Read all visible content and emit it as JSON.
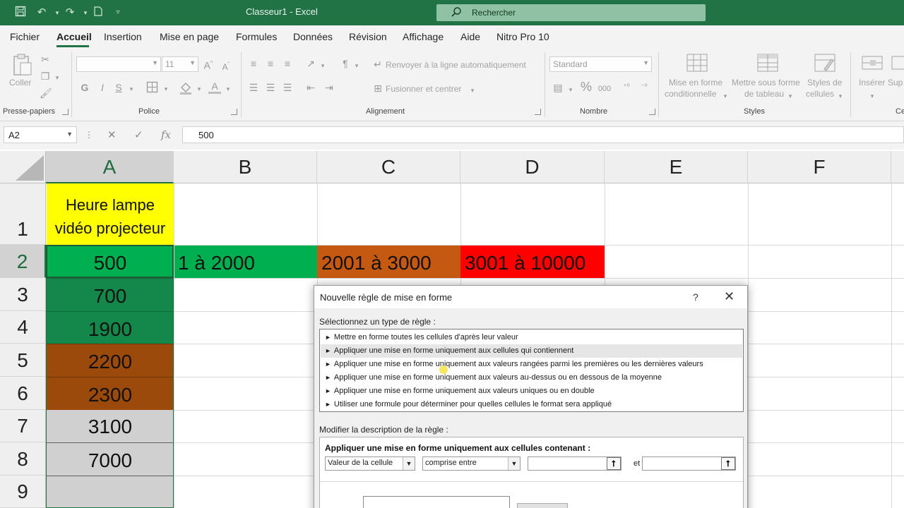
{
  "titlebar": {
    "doc_title": "Classeur1  -  Excel",
    "search_placeholder": "Rechercher"
  },
  "menu": {
    "tabs": [
      "Fichier",
      "Accueil",
      "Insertion",
      "Mise en page",
      "Formules",
      "Données",
      "Révision",
      "Affichage",
      "Aide",
      "Nitro Pro 10"
    ],
    "active": "Accueil"
  },
  "ribbon": {
    "clipboard": {
      "paste_label": "Coller",
      "group_label": "Presse-papiers"
    },
    "font": {
      "font_name": "",
      "font_size": "11",
      "bold": "G",
      "italic": "I",
      "underline": "S",
      "group_label": "Police"
    },
    "alignment": {
      "wrap_text": "Renvoyer à la ligne automatiquement",
      "merge_center": "Fusionner et centrer",
      "group_label": "Alignement"
    },
    "number": {
      "format": "Standard",
      "group_label": "Nombre"
    },
    "styles": {
      "conditional": [
        "Mise en forme",
        "conditionnelle"
      ],
      "as_table": [
        "Mettre sous forme",
        "de tableau"
      ],
      "cell_styles": [
        "Styles de",
        "cellules"
      ],
      "group_label": "Styles"
    },
    "cells": {
      "insert": "Insérer",
      "next_partial": "Sup",
      "group_partial": "Ce"
    }
  },
  "formula_bar": {
    "name_box": "A2",
    "formula": "500"
  },
  "grid": {
    "columns": [
      "A",
      "B",
      "C",
      "D",
      "E",
      "F"
    ],
    "rows": [
      "1",
      "2",
      "3",
      "4",
      "5",
      "6",
      "7",
      "8",
      "9"
    ],
    "header_cell": [
      "Heure lampe",
      "vidéo projecteur"
    ],
    "column_a_values": [
      "500",
      "700",
      "1900",
      "2200",
      "2300",
      "3100",
      "7000"
    ],
    "legend": [
      "1 à 2000",
      "2001 à 3000",
      "3001 à 10000"
    ],
    "colors": {
      "yellow": "#ffff00",
      "green_light": "#00b050",
      "green_dark": "#14884a",
      "brown": "#9b4a0c",
      "orange": "#c65911",
      "red": "#ff0000",
      "gray": "#d0d0d0"
    }
  },
  "dialog": {
    "title": "Nouvelle règle de mise en forme",
    "help": "?",
    "select_label": "Sélectionnez un type de règle :",
    "rule_types": [
      "Mettre en forme toutes les cellules d'après leur valeur",
      "Appliquer une mise en forme uniquement aux cellules qui contiennent",
      "Appliquer une mise en forme uniquement aux valeurs rangées parmi les premières ou les dernières valeurs",
      "Appliquer une mise en forme uniquement aux valeurs au-dessus ou en dessous de la moyenne",
      "Appliquer une mise en forme uniquement aux valeurs uniques ou en double",
      "Utiliser une formule pour déterminer pour quelles cellules le format sera appliqué"
    ],
    "selected_rule_index": 1,
    "modify_label": "Modifier la description de la règle :",
    "desc_title": "Appliquer une mise en forme uniquement aux cellules contenant :",
    "condition_field": "Valeur de la cellule",
    "condition_operator": "comprise entre",
    "and_label": "et",
    "value1": "",
    "value2": ""
  }
}
